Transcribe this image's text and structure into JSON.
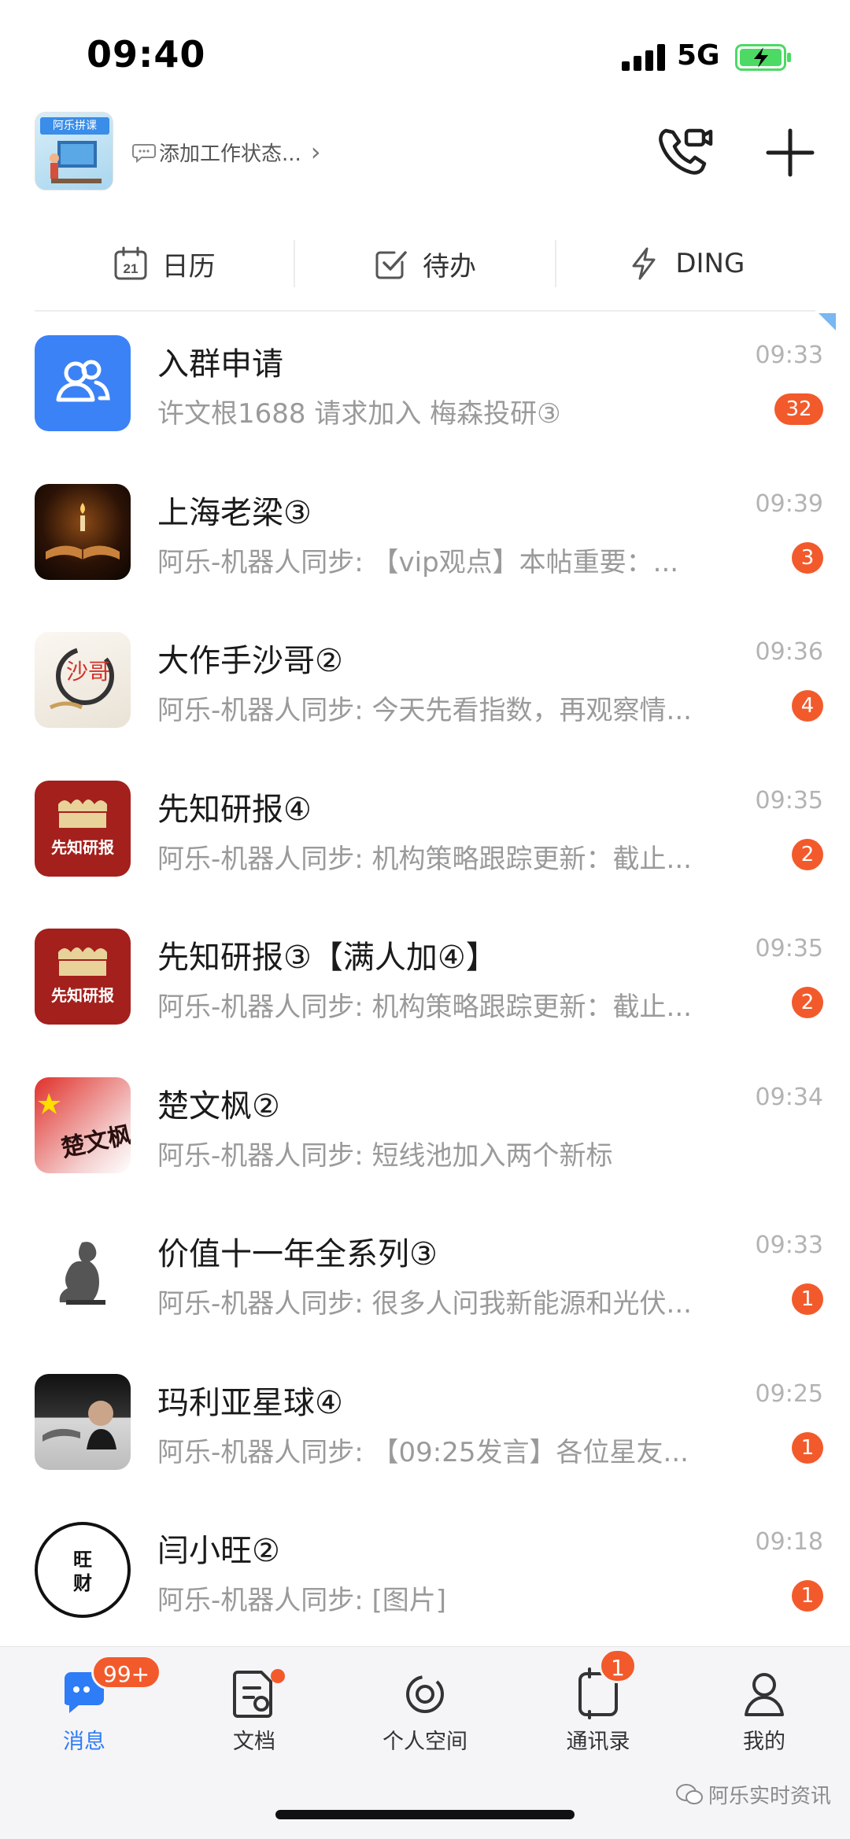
{
  "status_bar": {
    "time": "09:40",
    "network": "5G"
  },
  "header": {
    "org_logo_text": "阿乐拼课",
    "work_status": "添加工作状态...",
    "chevron": "›"
  },
  "quick_tabs": [
    {
      "label": "日历",
      "icon": "calendar-icon",
      "day": "21"
    },
    {
      "label": "待办",
      "icon": "todo-check-icon"
    },
    {
      "label": "DING",
      "icon": "ding-bolt-icon"
    }
  ],
  "conversations": [
    {
      "title": "入群申请",
      "preview": "许文根1688 请求加入 梅森投研③",
      "time": "09:33",
      "badge": "32",
      "avatar": "group-join-icon",
      "pinned": true
    },
    {
      "title": "上海老梁③",
      "preview": "阿乐-机器人同步: 【vip观点】本帖重要：...",
      "time": "09:39",
      "badge": "3",
      "avatar": "book-candle-avatar"
    },
    {
      "title": "大作手沙哥②",
      "preview": "阿乐-机器人同步: 今天先看指数，再观察情...",
      "time": "09:36",
      "badge": "4",
      "avatar": "shage-avatar",
      "avatar_text": "沙哥"
    },
    {
      "title": "先知研报④",
      "preview": "阿乐-机器人同步: 机构策略跟踪更新：截止...",
      "time": "09:35",
      "badge": "2",
      "avatar": "xianzhi-avatar",
      "avatar_text": "先知研报"
    },
    {
      "title": "先知研报③【满人加④】",
      "preview": "阿乐-机器人同步: 机构策略跟踪更新：截止...",
      "time": "09:35",
      "badge": "2",
      "avatar": "xianzhi-avatar",
      "avatar_text": "先知研报"
    },
    {
      "title": "楚文枫②",
      "preview": "阿乐-机器人同步: 短线池加入两个新标",
      "time": "09:34",
      "badge": "",
      "avatar": "flag-avatar",
      "avatar_text": "楚文枫"
    },
    {
      "title": "价值十一年全系列③",
      "preview": "阿乐-机器人同步: 很多人问我新能源和光伏...",
      "time": "09:33",
      "badge": "1",
      "avatar": "thinker-avatar"
    },
    {
      "title": "玛利亚星球④",
      "preview": "阿乐-机器人同步: 【09:25发言】各位星友...",
      "time": "09:25",
      "badge": "1",
      "avatar": "photo-avatar"
    },
    {
      "title": "闫小旺②",
      "preview": "阿乐-机器人同步: [图片]",
      "time": "09:18",
      "badge": "1",
      "avatar": "wangcai-avatar",
      "avatar_text": "旺财"
    }
  ],
  "tab_bar": {
    "tabs": [
      {
        "label": "消息",
        "icon": "message-icon",
        "badge": "99+",
        "active": true
      },
      {
        "label": "文档",
        "icon": "document-icon",
        "dot": true
      },
      {
        "label": "个人空间",
        "icon": "personal-space-icon"
      },
      {
        "label": "通讯录",
        "icon": "contacts-icon",
        "badge": "1"
      },
      {
        "label": "我的",
        "icon": "profile-icon"
      }
    ]
  },
  "watermark": "阿乐实时资讯",
  "colors": {
    "accent": "#2e7cf6",
    "badge": "#f25a2c",
    "battery_fill": "#4cd964"
  }
}
